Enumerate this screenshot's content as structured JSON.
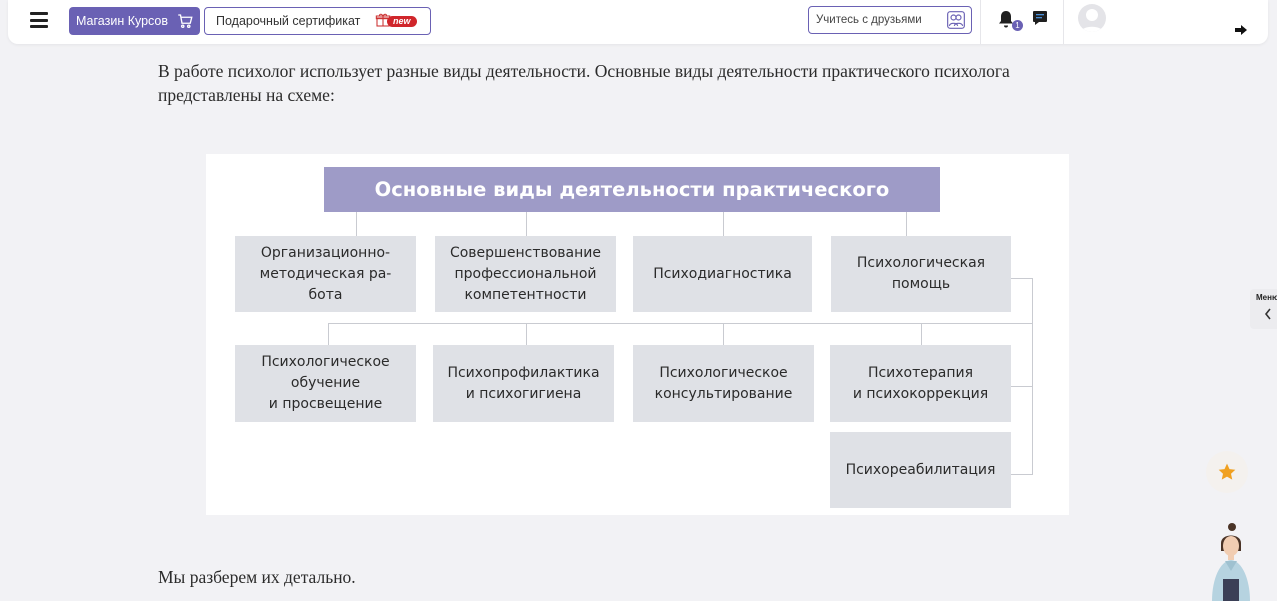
{
  "topbar": {
    "shop_label": "Магазин Курсов",
    "gift_label": "Подарочный сертификат",
    "gift_badge": "new",
    "friends_label": "Учитесь с друзьями",
    "notification_count": "1",
    "accent_color": "#6a61b4"
  },
  "content": {
    "intro": "В работе психолог использует разные виды деятельности. Основные виды деятельности практического психолога представлены на схеме:",
    "outro": "Мы разберем их детально."
  },
  "diagram": {
    "title": "Основные виды деятельности практического психолога",
    "row1": [
      "Организационно-\nметодическая  ра-\nбота",
      "Совершенствование\nпрофессиональной\nкомпетентности",
      "Психодиагностика",
      "Психологическая\nпомощь"
    ],
    "row2": [
      "Психологическое\nобучение\nи просвещение",
      "Психопрофилактика\nи психогигиена",
      "Психологическое\nконсультирование",
      "Психотерапия\nи психокоррекция"
    ],
    "row3": [
      "Психореабилитация"
    ]
  },
  "sidebar": {
    "menu_label": "Меню"
  },
  "icons": {
    "menu": "hamburger-icon",
    "cart": "cart-icon",
    "gift": "gift-icon",
    "friends": "friends-icon",
    "bell": "bell-icon",
    "chat": "chat-icon",
    "logout": "logout-icon",
    "star": "star-icon",
    "chevron": "chevron-left-icon"
  }
}
